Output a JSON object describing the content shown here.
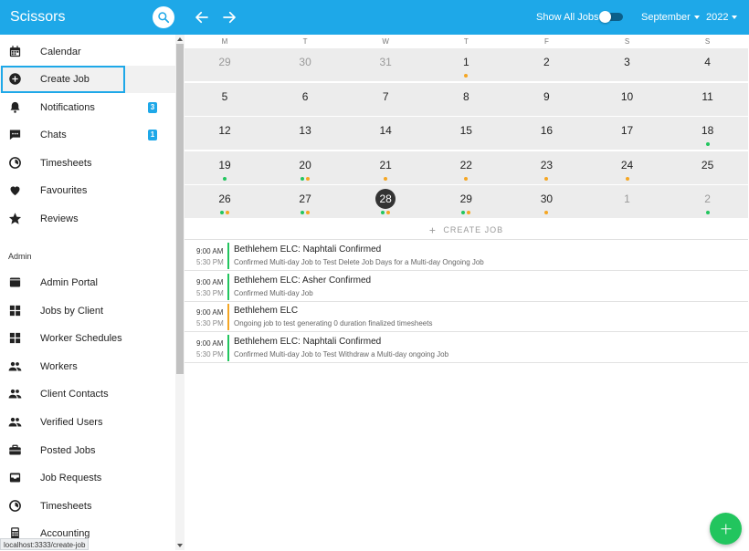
{
  "header": {
    "brand": "Scissors",
    "show_all_label": "Show All Jobs",
    "month": "September",
    "year": "2022"
  },
  "sidebar": {
    "items": [
      {
        "label": "Calendar",
        "icon": "calendar-icon"
      },
      {
        "label": "Create Job",
        "icon": "plus-circle-icon",
        "active": true
      },
      {
        "label": "Notifications",
        "icon": "bell-icon",
        "badge": "3"
      },
      {
        "label": "Chats",
        "icon": "chat-icon",
        "badge": "1"
      },
      {
        "label": "Timesheets",
        "icon": "timer-icon"
      },
      {
        "label": "Favourites",
        "icon": "heart-icon"
      },
      {
        "label": "Reviews",
        "icon": "star-icon"
      }
    ],
    "admin_heading": "Admin",
    "admin_items": [
      {
        "label": "Admin Portal",
        "icon": "portal-icon"
      },
      {
        "label": "Jobs by Client",
        "icon": "grid-icon"
      },
      {
        "label": "Worker Schedules",
        "icon": "grid-icon"
      },
      {
        "label": "Workers",
        "icon": "people-icon"
      },
      {
        "label": "Client Contacts",
        "icon": "people-icon"
      },
      {
        "label": "Verified Users",
        "icon": "people-icon"
      },
      {
        "label": "Posted Jobs",
        "icon": "briefcase-icon"
      },
      {
        "label": "Job Requests",
        "icon": "inbox-icon"
      },
      {
        "label": "Timesheets",
        "icon": "timer-icon"
      },
      {
        "label": "Accounting",
        "icon": "calculator-icon"
      }
    ]
  },
  "status_url": "localhost:3333/create-job",
  "calendar": {
    "weekdays": [
      "M",
      "T",
      "W",
      "T",
      "F",
      "S",
      "S"
    ],
    "weeks": [
      [
        {
          "d": "29",
          "o": true
        },
        {
          "d": "30",
          "o": true
        },
        {
          "d": "31",
          "o": true
        },
        {
          "d": "1",
          "dots": [
            "orange"
          ]
        },
        {
          "d": "2"
        },
        {
          "d": "3"
        },
        {
          "d": "4"
        }
      ],
      [
        {
          "d": "5"
        },
        {
          "d": "6"
        },
        {
          "d": "7"
        },
        {
          "d": "8"
        },
        {
          "d": "9"
        },
        {
          "d": "10"
        },
        {
          "d": "11"
        }
      ],
      [
        {
          "d": "12"
        },
        {
          "d": "13"
        },
        {
          "d": "14"
        },
        {
          "d": "15"
        },
        {
          "d": "16"
        },
        {
          "d": "17"
        },
        {
          "d": "18",
          "dots": [
            "green"
          ]
        }
      ],
      [
        {
          "d": "19",
          "dots": [
            "green"
          ]
        },
        {
          "d": "20",
          "dots": [
            "green",
            "orange"
          ]
        },
        {
          "d": "21",
          "dots": [
            "orange"
          ]
        },
        {
          "d": "22",
          "dots": [
            "orange"
          ]
        },
        {
          "d": "23",
          "dots": [
            "orange"
          ]
        },
        {
          "d": "24",
          "dots": [
            "orange"
          ]
        },
        {
          "d": "25"
        }
      ],
      [
        {
          "d": "26",
          "dots": [
            "green",
            "orange"
          ]
        },
        {
          "d": "27",
          "dots": [
            "green",
            "orange"
          ]
        },
        {
          "d": "28",
          "today": true,
          "dots": [
            "green",
            "orange"
          ]
        },
        {
          "d": "29",
          "dots": [
            "green",
            "orange"
          ]
        },
        {
          "d": "30",
          "dots": [
            "orange"
          ]
        },
        {
          "d": "1",
          "o": true
        },
        {
          "d": "2",
          "o": true,
          "dots": [
            "green"
          ]
        }
      ]
    ],
    "create_job_label": "CREATE JOB"
  },
  "events": [
    {
      "start": "9:00 AM",
      "end": "5:30 PM",
      "title": "Bethlehem ELC: Naphtali Confirmed",
      "sub": "Confirmed Multi-day Job to Test Delete Job Days for a Multi-day Ongoing Job",
      "color": "green"
    },
    {
      "start": "9:00 AM",
      "end": "5:30 PM",
      "title": "Bethlehem ELC: Asher Confirmed",
      "sub": "Confirmed Multi-day Job",
      "color": "green"
    },
    {
      "start": "9:00 AM",
      "end": "5:30 PM",
      "title": "Bethlehem ELC",
      "sub": "Ongoing job to test generating 0 duration finalized timesheets",
      "color": "orange"
    },
    {
      "start": "9:00 AM",
      "end": "5:30 PM",
      "title": "Bethlehem ELC: Naphtali Confirmed",
      "sub": "Confirmed Multi-day Job to Test Withdraw a Multi-day ongoing Job",
      "color": "green"
    }
  ],
  "colors": {
    "brand": "#1ea8e8",
    "green": "#22c55e",
    "orange": "#f5a623",
    "fab": "#22c55e"
  }
}
